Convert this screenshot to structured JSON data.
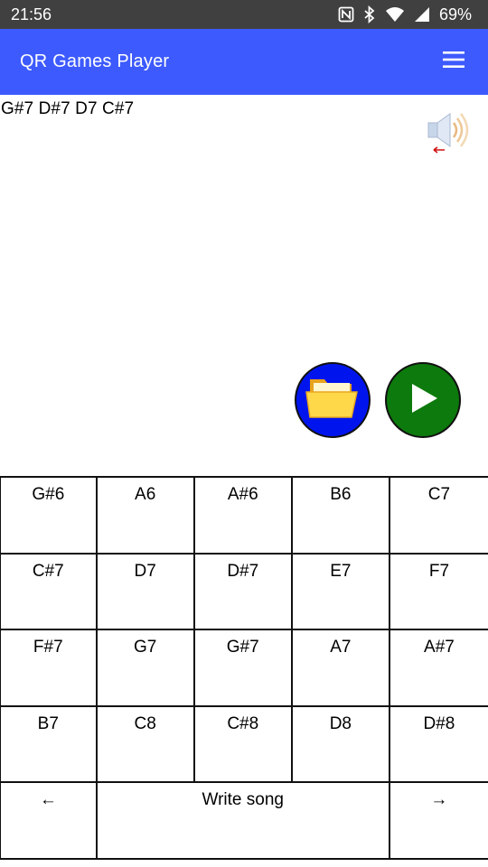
{
  "status_bar": {
    "time": "21:56",
    "battery": "69%",
    "icons": [
      "nfc-icon",
      "bluetooth-icon",
      "wifi-icon",
      "signal-icon"
    ]
  },
  "app_bar": {
    "title": "QR Games Player",
    "menu_icon": "hamburger-menu-icon",
    "color": "#3d5afe"
  },
  "sequence_text": "G#7 D#7 D7 C#7",
  "buttons": {
    "open_icon": "folder-icon",
    "open_color": "#0015ee",
    "play_icon": "play-icon",
    "play_color": "#0c7a0c",
    "sound_icon": "speaker-icon"
  },
  "notes": [
    [
      "G#6",
      "A6",
      "A#6",
      "B6",
      "C7"
    ],
    [
      "C#7",
      "D7",
      "D#7",
      "E7",
      "F7"
    ],
    [
      "F#7",
      "G7",
      "G#7",
      "A7",
      "A#7"
    ],
    [
      "B7",
      "C8",
      "C#8",
      "D8",
      "D#8"
    ]
  ],
  "bottom_row": {
    "back": "←",
    "write_song": "Write song",
    "forward": "→"
  }
}
